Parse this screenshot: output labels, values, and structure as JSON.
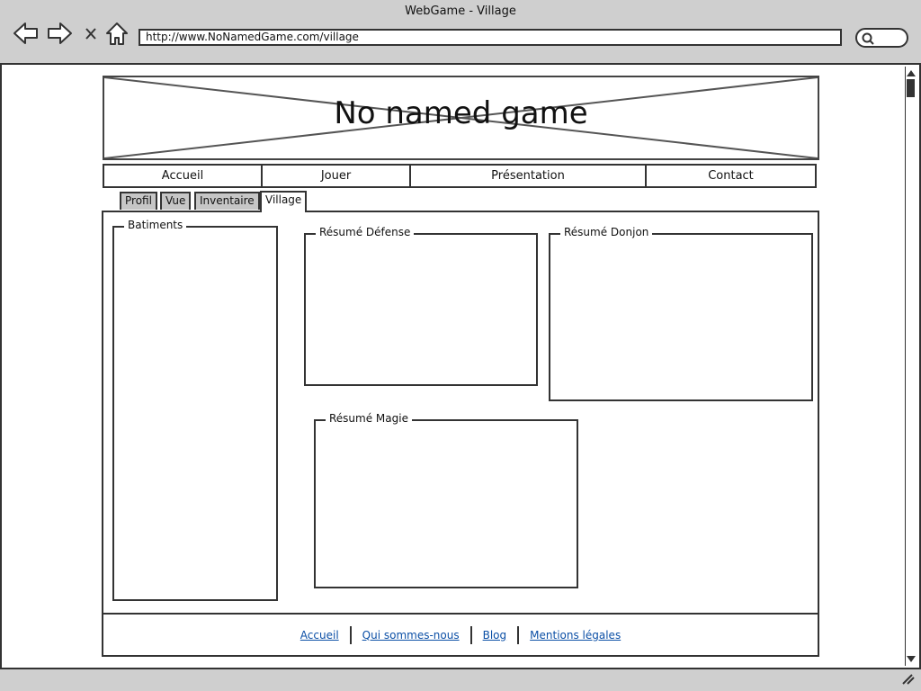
{
  "window": {
    "title": "WebGame - Village"
  },
  "browser": {
    "url": "http://www.NoNamedGame.com/village"
  },
  "header": {
    "title": "No named game"
  },
  "nav": {
    "items": [
      {
        "label": "Accueil"
      },
      {
        "label": "Jouer"
      },
      {
        "label": "Présentation"
      },
      {
        "label": "Contact"
      }
    ]
  },
  "tabs": {
    "items": [
      {
        "label": "Profil"
      },
      {
        "label": "Vue"
      },
      {
        "label": "Inventaire"
      },
      {
        "label": "Village"
      }
    ],
    "active": "Village"
  },
  "panels": {
    "batiments": "Batiments",
    "defense": "Résumé Défense",
    "donjon": "Résumé Donjon",
    "magie": "Résumé Magie"
  },
  "footer": {
    "links": [
      {
        "label": "Accueil"
      },
      {
        "label": "Qui sommes-nous"
      },
      {
        "label": "Blog"
      },
      {
        "label": "Mentions légales"
      }
    ]
  }
}
